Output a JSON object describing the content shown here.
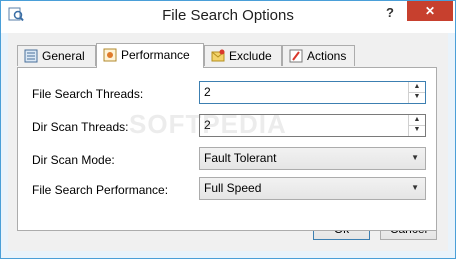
{
  "window": {
    "title": "File Search Options",
    "help_label": "?",
    "close_label": "✕"
  },
  "tabs": [
    {
      "label": "General",
      "icon": "general-icon",
      "active": false
    },
    {
      "label": "Performance",
      "icon": "performance-icon",
      "active": true
    },
    {
      "label": "Exclude",
      "icon": "exclude-icon",
      "active": false
    },
    {
      "label": "Actions",
      "icon": "actions-icon",
      "active": false
    }
  ],
  "form": {
    "file_search_threads": {
      "label": "File Search Threads:",
      "value": "2"
    },
    "dir_scan_threads": {
      "label": "Dir Scan Threads:",
      "value": "2"
    },
    "dir_scan_mode": {
      "label": "Dir Scan Mode:",
      "value": "Fault Tolerant"
    },
    "file_search_performance": {
      "label": "File Search Performance:",
      "value": "Full Speed"
    }
  },
  "buttons": {
    "ok_label": "Ok",
    "cancel_label": "Cancel"
  },
  "watermark": "SOFTPEDIA",
  "colors": {
    "accent": "#3c7fb1",
    "close_button": "#c7402e",
    "frame": "#e9f3fb"
  }
}
